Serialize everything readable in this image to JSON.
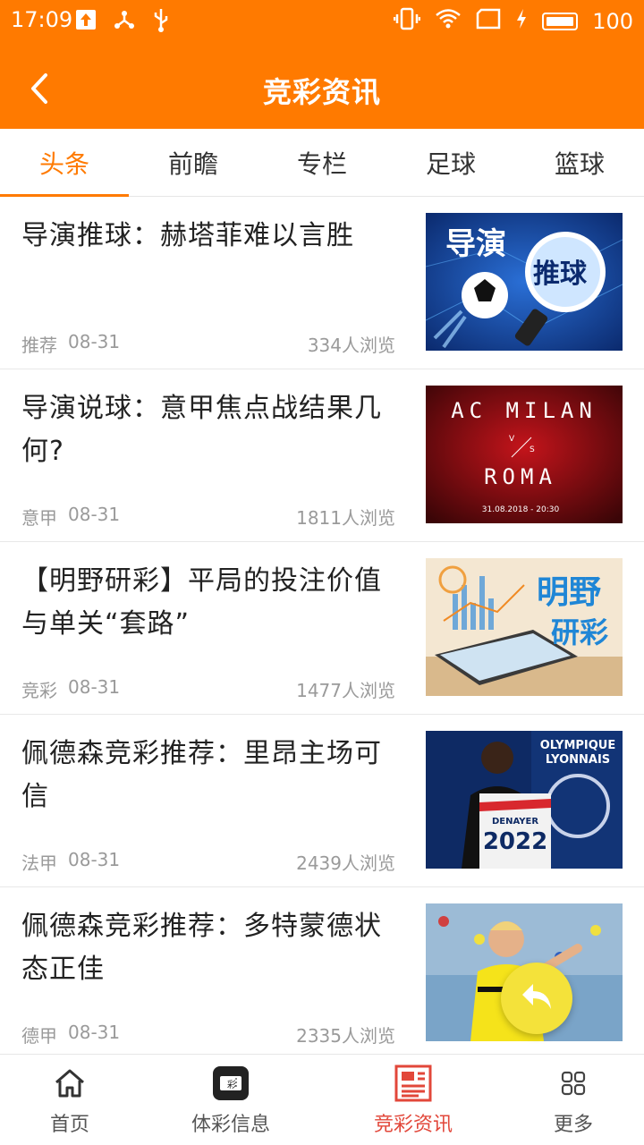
{
  "status_bar": {
    "time": "17:09",
    "battery": "100",
    "left_icons": [
      "upload-icon",
      "share-icon",
      "usb-icon"
    ],
    "right_icons": [
      "vibrate-icon",
      "wifi-icon",
      "sim-icon",
      "charging-icon",
      "battery-icon"
    ]
  },
  "header": {
    "title": "竞彩资讯",
    "back_icon": "chevron-left-icon",
    "color": "#FF7A00"
  },
  "tabs": [
    {
      "label": "头条",
      "active": true
    },
    {
      "label": "前瞻",
      "active": false
    },
    {
      "label": "专栏",
      "active": false
    },
    {
      "label": "足球",
      "active": false
    },
    {
      "label": "篮球",
      "active": false
    }
  ],
  "articles": [
    {
      "title": "导演推球：赫塔菲难以言胜",
      "category": "推荐",
      "date": "08-31",
      "views": "334人浏览",
      "thumb_text": [
        "导演",
        "推球"
      ]
    },
    {
      "title": "导演说球：意甲焦点战结果几何?",
      "category": "意甲",
      "date": "08-31",
      "views": "1811人浏览",
      "thumb_text": [
        "AC MILAN",
        "V",
        "S",
        "ROMA",
        "31.08.2018 - 20:30"
      ]
    },
    {
      "title": "【明野研彩】平局的投注价值与单关“套路”",
      "category": "竞彩",
      "date": "08-31",
      "views": "1477人浏览",
      "thumb_text": [
        "明野",
        "研彩"
      ]
    },
    {
      "title": "佩德森竞彩推荐：里昂主场可信",
      "category": "法甲",
      "date": "08-31",
      "views": "2439人浏览",
      "thumb_text": [
        "OLYMPIQUE",
        "LYONNAIS",
        "DENAYER",
        "2022"
      ]
    },
    {
      "title": "佩德森竞彩推荐：多特蒙德状态正佳",
      "category": "德甲",
      "date": "08-31",
      "views": "2335人浏览",
      "thumb_text": []
    }
  ],
  "fab": {
    "icon": "reply-icon"
  },
  "bottom_nav": [
    {
      "label": "首页",
      "icon": "home-icon",
      "active": false
    },
    {
      "label": "体彩信息",
      "icon": "lottery-tv-icon",
      "active": false
    },
    {
      "label": "竞彩资讯",
      "icon": "newspaper-icon",
      "active": true
    },
    {
      "label": "更多",
      "icon": "grid-icon",
      "active": false
    }
  ],
  "colors": {
    "accent": "#FF7A00",
    "active_nav": "#E2473A",
    "fab": "#F4E23A"
  }
}
